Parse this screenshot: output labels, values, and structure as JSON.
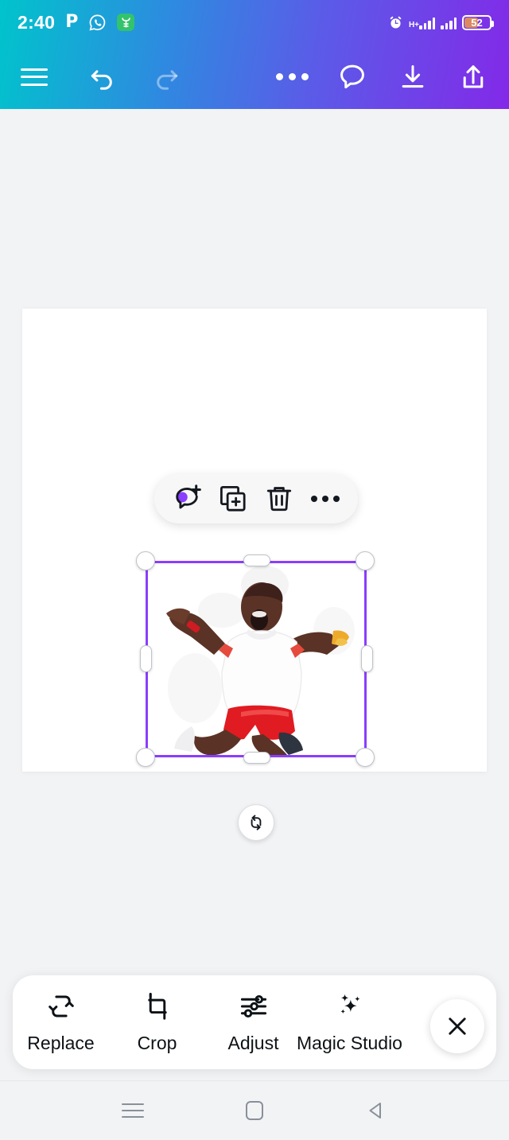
{
  "status_bar": {
    "time": "2:40",
    "left_icons": [
      "p-icon",
      "whatsapp-icon",
      "green-app-icon"
    ],
    "network_type": "H+",
    "battery_percent": "52",
    "right_icons": [
      "alarm-icon",
      "signal-bars-1-icon",
      "signal-bars-2-icon",
      "battery-icon"
    ]
  },
  "app_bar": {
    "menu_label": "hamburger-menu",
    "undo_label": "undo",
    "redo_label": "redo",
    "more_label": "more-options",
    "comment_label": "comments",
    "download_label": "download",
    "share_label": "share"
  },
  "object_toolbar": {
    "items": [
      {
        "name": "add-comment",
        "label": "Add comment"
      },
      {
        "name": "duplicate",
        "label": "Duplicate"
      },
      {
        "name": "delete",
        "label": "Delete"
      },
      {
        "name": "more",
        "label": "More"
      }
    ]
  },
  "canvas": {
    "selection": {
      "rotate_label": "Rotate",
      "border_color": "#8B3DFF",
      "handle_fill": "#FFFFFF"
    },
    "image_alt": "Celebrating athlete in white shirt and red shorts kneeling with arms raised"
  },
  "bottom_toolbar": {
    "tools": [
      {
        "label": "Replace",
        "icon": "replace-icon"
      },
      {
        "label": "Crop",
        "icon": "crop-icon"
      },
      {
        "label": "Adjust",
        "icon": "adjust-sliders-icon"
      },
      {
        "label": "Magic Studio",
        "icon": "sparkles-icon"
      }
    ],
    "close_label": "Close"
  },
  "nav_bar": {
    "recents_label": "Recents",
    "home_label": "Home",
    "back_label": "Back"
  },
  "colors": {
    "gradient_start": "#00C4CC",
    "gradient_end": "#8329E8",
    "accent_purple": "#8B3DFF",
    "background": "#F2F3F5"
  }
}
